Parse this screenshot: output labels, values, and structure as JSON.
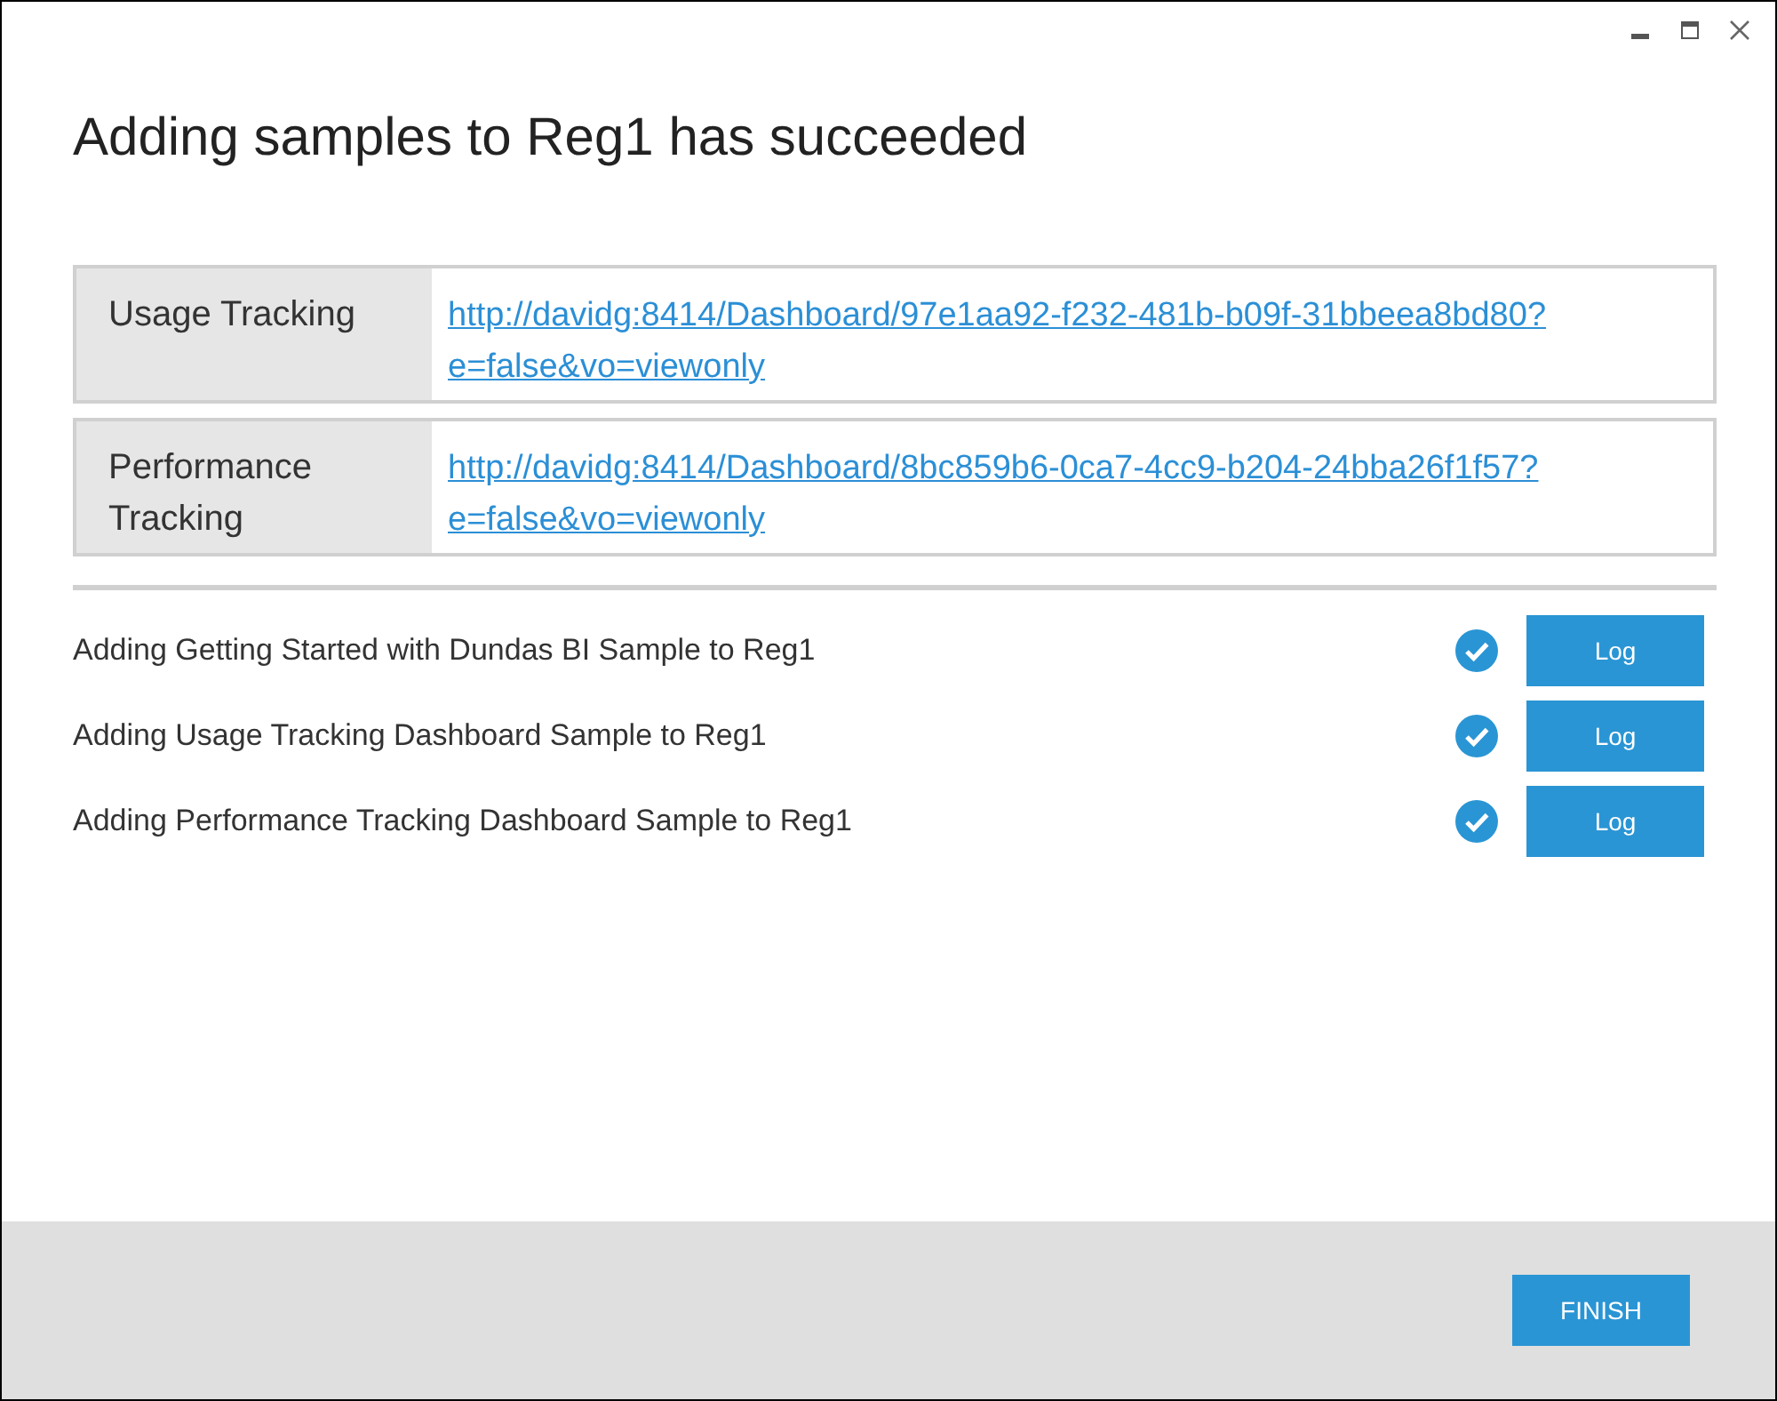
{
  "window": {
    "title": "Adding samples to Reg1 has succeeded"
  },
  "links": [
    {
      "label": "Usage Tracking",
      "url": "http://davidg:8414/Dashboard/97e1aa92-f232-481b-b09f-31bbeea8bd80?e=false&vo=viewonly"
    },
    {
      "label": "Performance Tracking",
      "url": "http://davidg:8414/Dashboard/8bc859b6-0ca7-4cc9-b204-24bba26f1f57?e=false&vo=viewonly"
    }
  ],
  "tasks": [
    {
      "text": "Adding Getting Started with Dundas BI Sample to Reg1",
      "succeeded": true,
      "button": "Log"
    },
    {
      "text": "Adding Usage Tracking Dashboard Sample to Reg1",
      "succeeded": true,
      "button": "Log"
    },
    {
      "text": "Adding Performance Tracking Dashboard Sample to Reg1",
      "succeeded": true,
      "button": "Log"
    }
  ],
  "footer": {
    "button": "FINISH"
  }
}
